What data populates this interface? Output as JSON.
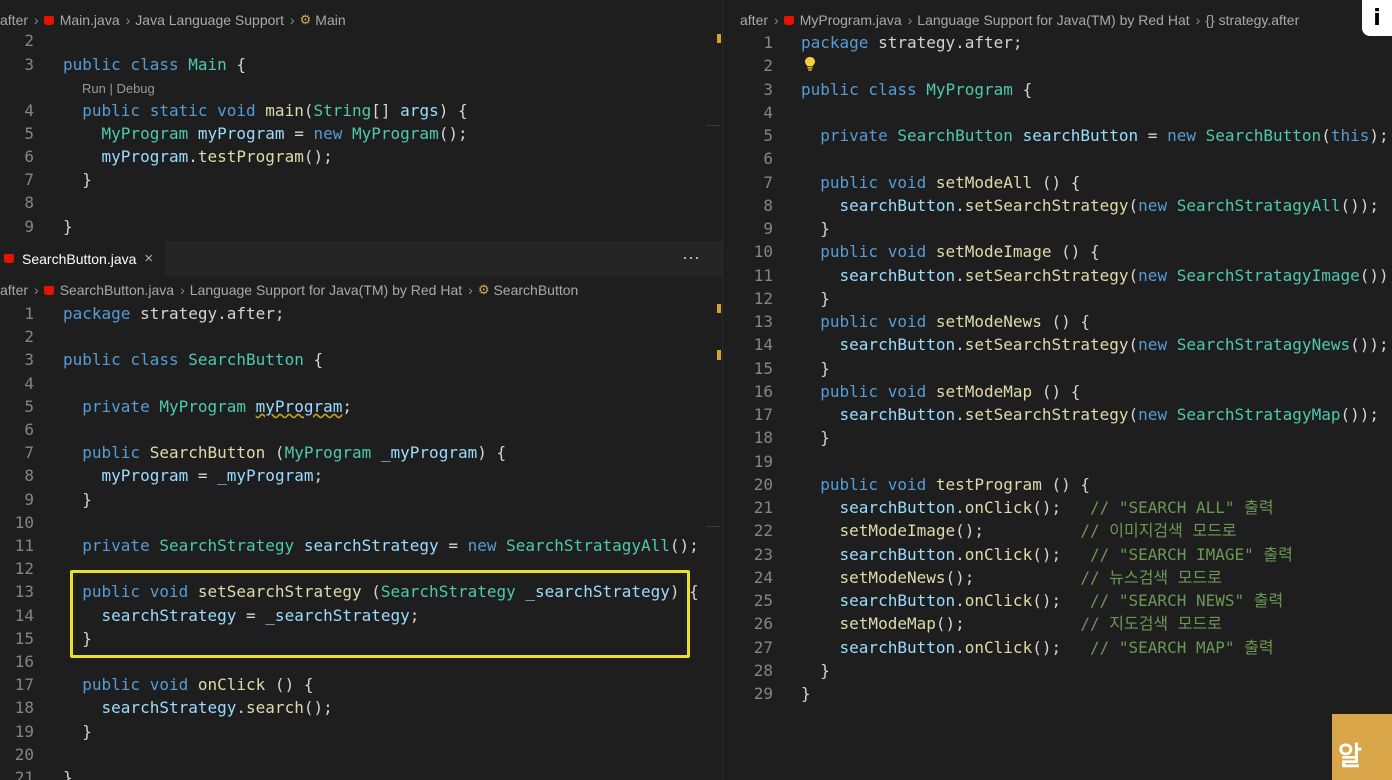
{
  "top_left": {
    "breadcrumb": [
      "after",
      "Main.java",
      "Java Language Support",
      "Main"
    ],
    "code_lens": "Run | Debug",
    "lines": [
      {
        "n": "2",
        "segs": []
      },
      {
        "n": "3",
        "segs": [
          [
            "k",
            "public class "
          ],
          [
            "t",
            "Main"
          ],
          [
            "p",
            " {"
          ]
        ]
      },
      {
        "n": "4",
        "segs": [
          [
            "p",
            "  "
          ],
          [
            "k",
            "public static void "
          ],
          [
            "f",
            "main"
          ],
          [
            "p",
            "("
          ],
          [
            "t",
            "String"
          ],
          [
            "p",
            "[] "
          ],
          [
            "v",
            "args"
          ],
          [
            "p",
            ") {"
          ]
        ]
      },
      {
        "n": "5",
        "segs": [
          [
            "p",
            "    "
          ],
          [
            "t",
            "MyProgram "
          ],
          [
            "v",
            "myProgram"
          ],
          [
            "p",
            " = "
          ],
          [
            "k",
            "new "
          ],
          [
            "t",
            "MyProgram"
          ],
          [
            "p",
            "();"
          ]
        ]
      },
      {
        "n": "6",
        "segs": [
          [
            "p",
            "    "
          ],
          [
            "v",
            "myProgram"
          ],
          [
            "p",
            "."
          ],
          [
            "f",
            "testProgram"
          ],
          [
            "p",
            "();"
          ]
        ]
      },
      {
        "n": "7",
        "segs": [
          [
            "p",
            "  }"
          ]
        ]
      },
      {
        "n": "8",
        "segs": []
      },
      {
        "n": "9",
        "segs": [
          [
            "p",
            "}"
          ]
        ]
      }
    ]
  },
  "bottom_left": {
    "tab_label": "SearchButton.java",
    "tab_close": "×",
    "more": "···",
    "breadcrumb": [
      "after",
      "SearchButton.java",
      "Language Support for Java(TM) by Red Hat",
      "SearchButton"
    ],
    "lines": [
      {
        "n": "1",
        "segs": [
          [
            "k",
            "package "
          ],
          [
            "p",
            "strategy.after;"
          ]
        ]
      },
      {
        "n": "2",
        "segs": []
      },
      {
        "n": "3",
        "segs": [
          [
            "k",
            "public class "
          ],
          [
            "t",
            "SearchButton"
          ],
          [
            "p",
            " {"
          ]
        ]
      },
      {
        "n": "4",
        "segs": []
      },
      {
        "n": "5",
        "segs": [
          [
            "p",
            "  "
          ],
          [
            "k",
            "private "
          ],
          [
            "t",
            "MyProgram "
          ],
          [
            "vs",
            "myProgram"
          ],
          [
            "p",
            ";"
          ]
        ]
      },
      {
        "n": "6",
        "segs": []
      },
      {
        "n": "7",
        "segs": [
          [
            "p",
            "  "
          ],
          [
            "k",
            "public "
          ],
          [
            "f",
            "SearchButton"
          ],
          [
            "p",
            " ("
          ],
          [
            "t",
            "MyProgram "
          ],
          [
            "v",
            "_myProgram"
          ],
          [
            "p",
            ") {"
          ]
        ]
      },
      {
        "n": "8",
        "segs": [
          [
            "p",
            "    "
          ],
          [
            "v",
            "myProgram"
          ],
          [
            "p",
            " = "
          ],
          [
            "v",
            "_myProgram"
          ],
          [
            "p",
            ";"
          ]
        ]
      },
      {
        "n": "9",
        "segs": [
          [
            "p",
            "  }"
          ]
        ]
      },
      {
        "n": "10",
        "segs": []
      },
      {
        "n": "11",
        "segs": [
          [
            "p",
            "  "
          ],
          [
            "k",
            "private "
          ],
          [
            "t",
            "SearchStrategy "
          ],
          [
            "v",
            "searchStrategy"
          ],
          [
            "p",
            " = "
          ],
          [
            "k",
            "new "
          ],
          [
            "t",
            "SearchStratagyAll"
          ],
          [
            "p",
            "();"
          ]
        ]
      },
      {
        "n": "12",
        "segs": []
      },
      {
        "n": "13",
        "segs": [
          [
            "p",
            "  "
          ],
          [
            "k",
            "public void "
          ],
          [
            "f",
            "setSearchStrategy"
          ],
          [
            "p",
            " ("
          ],
          [
            "t",
            "SearchStrategy "
          ],
          [
            "v",
            "_searchStrategy"
          ],
          [
            "p",
            ") {"
          ]
        ]
      },
      {
        "n": "14",
        "segs": [
          [
            "p",
            "    "
          ],
          [
            "v",
            "searchStrategy"
          ],
          [
            "p",
            " = "
          ],
          [
            "v",
            "_searchStrategy"
          ],
          [
            "p",
            ";"
          ]
        ]
      },
      {
        "n": "15",
        "segs": [
          [
            "p",
            "  }"
          ]
        ]
      },
      {
        "n": "16",
        "segs": []
      },
      {
        "n": "17",
        "segs": [
          [
            "p",
            "  "
          ],
          [
            "k",
            "public void "
          ],
          [
            "f",
            "onClick"
          ],
          [
            "p",
            " () {"
          ]
        ]
      },
      {
        "n": "18",
        "segs": [
          [
            "p",
            "    "
          ],
          [
            "v",
            "searchStrategy"
          ],
          [
            "p",
            "."
          ],
          [
            "f",
            "search"
          ],
          [
            "p",
            "();"
          ]
        ]
      },
      {
        "n": "19",
        "segs": [
          [
            "p",
            "  }"
          ]
        ]
      },
      {
        "n": "20",
        "segs": []
      },
      {
        "n": "21",
        "segs": [
          [
            "p",
            "}"
          ]
        ]
      }
    ]
  },
  "right": {
    "breadcrumb": [
      "after",
      "MyProgram.java",
      "Language Support for Java(TM) by Red Hat",
      "{} strategy.after"
    ],
    "lines": [
      {
        "n": "1",
        "segs": [
          [
            "k",
            "package "
          ],
          [
            "p",
            "strategy.after;"
          ]
        ]
      },
      {
        "n": "2",
        "segs": []
      },
      {
        "n": "3",
        "segs": [
          [
            "k",
            "public class "
          ],
          [
            "t",
            "MyProgram"
          ],
          [
            "p",
            " {"
          ]
        ]
      },
      {
        "n": "4",
        "segs": []
      },
      {
        "n": "5",
        "segs": [
          [
            "p",
            "  "
          ],
          [
            "k",
            "private "
          ],
          [
            "t",
            "SearchButton "
          ],
          [
            "v",
            "searchButton"
          ],
          [
            "p",
            " = "
          ],
          [
            "k",
            "new "
          ],
          [
            "t",
            "SearchButton"
          ],
          [
            "p",
            "("
          ],
          [
            "k",
            "this"
          ],
          [
            "p",
            ");"
          ]
        ]
      },
      {
        "n": "6",
        "segs": []
      },
      {
        "n": "7",
        "segs": [
          [
            "p",
            "  "
          ],
          [
            "k",
            "public void "
          ],
          [
            "f",
            "setModeAll"
          ],
          [
            "p",
            " () {"
          ]
        ]
      },
      {
        "n": "8",
        "segs": [
          [
            "p",
            "    "
          ],
          [
            "v",
            "searchButton"
          ],
          [
            "p",
            "."
          ],
          [
            "f",
            "setSearchStrategy"
          ],
          [
            "p",
            "("
          ],
          [
            "k",
            "new "
          ],
          [
            "t",
            "SearchStratagyAll"
          ],
          [
            "p",
            "());"
          ]
        ]
      },
      {
        "n": "9",
        "segs": [
          [
            "p",
            "  }"
          ]
        ]
      },
      {
        "n": "10",
        "segs": [
          [
            "p",
            "  "
          ],
          [
            "k",
            "public void "
          ],
          [
            "f",
            "setModeImage"
          ],
          [
            "p",
            " () {"
          ]
        ]
      },
      {
        "n": "11",
        "segs": [
          [
            "p",
            "    "
          ],
          [
            "v",
            "searchButton"
          ],
          [
            "p",
            "."
          ],
          [
            "f",
            "setSearchStrategy"
          ],
          [
            "p",
            "("
          ],
          [
            "k",
            "new "
          ],
          [
            "t",
            "SearchStratagyImage"
          ],
          [
            "p",
            "());"
          ]
        ]
      },
      {
        "n": "12",
        "segs": [
          [
            "p",
            "  }"
          ]
        ]
      },
      {
        "n": "13",
        "segs": [
          [
            "p",
            "  "
          ],
          [
            "k",
            "public void "
          ],
          [
            "f",
            "setModeNews"
          ],
          [
            "p",
            " () {"
          ]
        ]
      },
      {
        "n": "14",
        "segs": [
          [
            "p",
            "    "
          ],
          [
            "v",
            "searchButton"
          ],
          [
            "p",
            "."
          ],
          [
            "f",
            "setSearchStrategy"
          ],
          [
            "p",
            "("
          ],
          [
            "k",
            "new "
          ],
          [
            "t",
            "SearchStratagyNews"
          ],
          [
            "p",
            "());"
          ]
        ]
      },
      {
        "n": "15",
        "segs": [
          [
            "p",
            "  }"
          ]
        ]
      },
      {
        "n": "16",
        "segs": [
          [
            "p",
            "  "
          ],
          [
            "k",
            "public void "
          ],
          [
            "f",
            "setModeMap"
          ],
          [
            "p",
            " () {"
          ]
        ]
      },
      {
        "n": "17",
        "segs": [
          [
            "p",
            "    "
          ],
          [
            "v",
            "searchButton"
          ],
          [
            "p",
            "."
          ],
          [
            "f",
            "setSearchStrategy"
          ],
          [
            "p",
            "("
          ],
          [
            "k",
            "new "
          ],
          [
            "t",
            "SearchStratagyMap"
          ],
          [
            "p",
            "());"
          ]
        ]
      },
      {
        "n": "18",
        "segs": [
          [
            "p",
            "  }"
          ]
        ]
      },
      {
        "n": "19",
        "segs": []
      },
      {
        "n": "20",
        "segs": [
          [
            "p",
            "  "
          ],
          [
            "k",
            "public void "
          ],
          [
            "f",
            "testProgram"
          ],
          [
            "p",
            " () {"
          ]
        ]
      },
      {
        "n": "21",
        "segs": [
          [
            "p",
            "    "
          ],
          [
            "v",
            "searchButton"
          ],
          [
            "p",
            "."
          ],
          [
            "f",
            "onClick"
          ],
          [
            "p",
            "();   "
          ],
          [
            "c",
            "// \"SEARCH ALL\" 출력"
          ]
        ]
      },
      {
        "n": "22",
        "segs": [
          [
            "p",
            "    "
          ],
          [
            "f",
            "setModeImage"
          ],
          [
            "p",
            "();          "
          ],
          [
            "c",
            "// 이미지검색 모드로"
          ]
        ]
      },
      {
        "n": "23",
        "segs": [
          [
            "p",
            "    "
          ],
          [
            "v",
            "searchButton"
          ],
          [
            "p",
            "."
          ],
          [
            "f",
            "onClick"
          ],
          [
            "p",
            "();   "
          ],
          [
            "c",
            "// \"SEARCH IMAGE\" 출력"
          ]
        ]
      },
      {
        "n": "24",
        "segs": [
          [
            "p",
            "    "
          ],
          [
            "f",
            "setModeNews"
          ],
          [
            "p",
            "();           "
          ],
          [
            "c",
            "// 뉴스검색 모드로"
          ]
        ]
      },
      {
        "n": "25",
        "segs": [
          [
            "p",
            "    "
          ],
          [
            "v",
            "searchButton"
          ],
          [
            "p",
            "."
          ],
          [
            "f",
            "onClick"
          ],
          [
            "p",
            "();   "
          ],
          [
            "c",
            "// \"SEARCH NEWS\" 출력"
          ]
        ]
      },
      {
        "n": "26",
        "segs": [
          [
            "p",
            "    "
          ],
          [
            "f",
            "setModeMap"
          ],
          [
            "p",
            "();            "
          ],
          [
            "c",
            "// 지도검색 모드로"
          ]
        ]
      },
      {
        "n": "27",
        "segs": [
          [
            "p",
            "    "
          ],
          [
            "v",
            "searchButton"
          ],
          [
            "p",
            "."
          ],
          [
            "f",
            "onClick"
          ],
          [
            "p",
            "();   "
          ],
          [
            "c",
            "// \"SEARCH MAP\" 출력"
          ]
        ]
      },
      {
        "n": "28",
        "segs": [
          [
            "p",
            "  }"
          ]
        ]
      },
      {
        "n": "29",
        "segs": [
          [
            "p",
            "}"
          ]
        ]
      }
    ]
  },
  "overlay": {
    "badge": "i",
    "corner_text": "알"
  },
  "colors": {
    "keyword": "#569cd6",
    "type": "#4ec9b0",
    "function": "#dcdcaa",
    "variable": "#9cdcfe",
    "comment": "#6a9955",
    "highlight_box": "#e6e02c"
  }
}
